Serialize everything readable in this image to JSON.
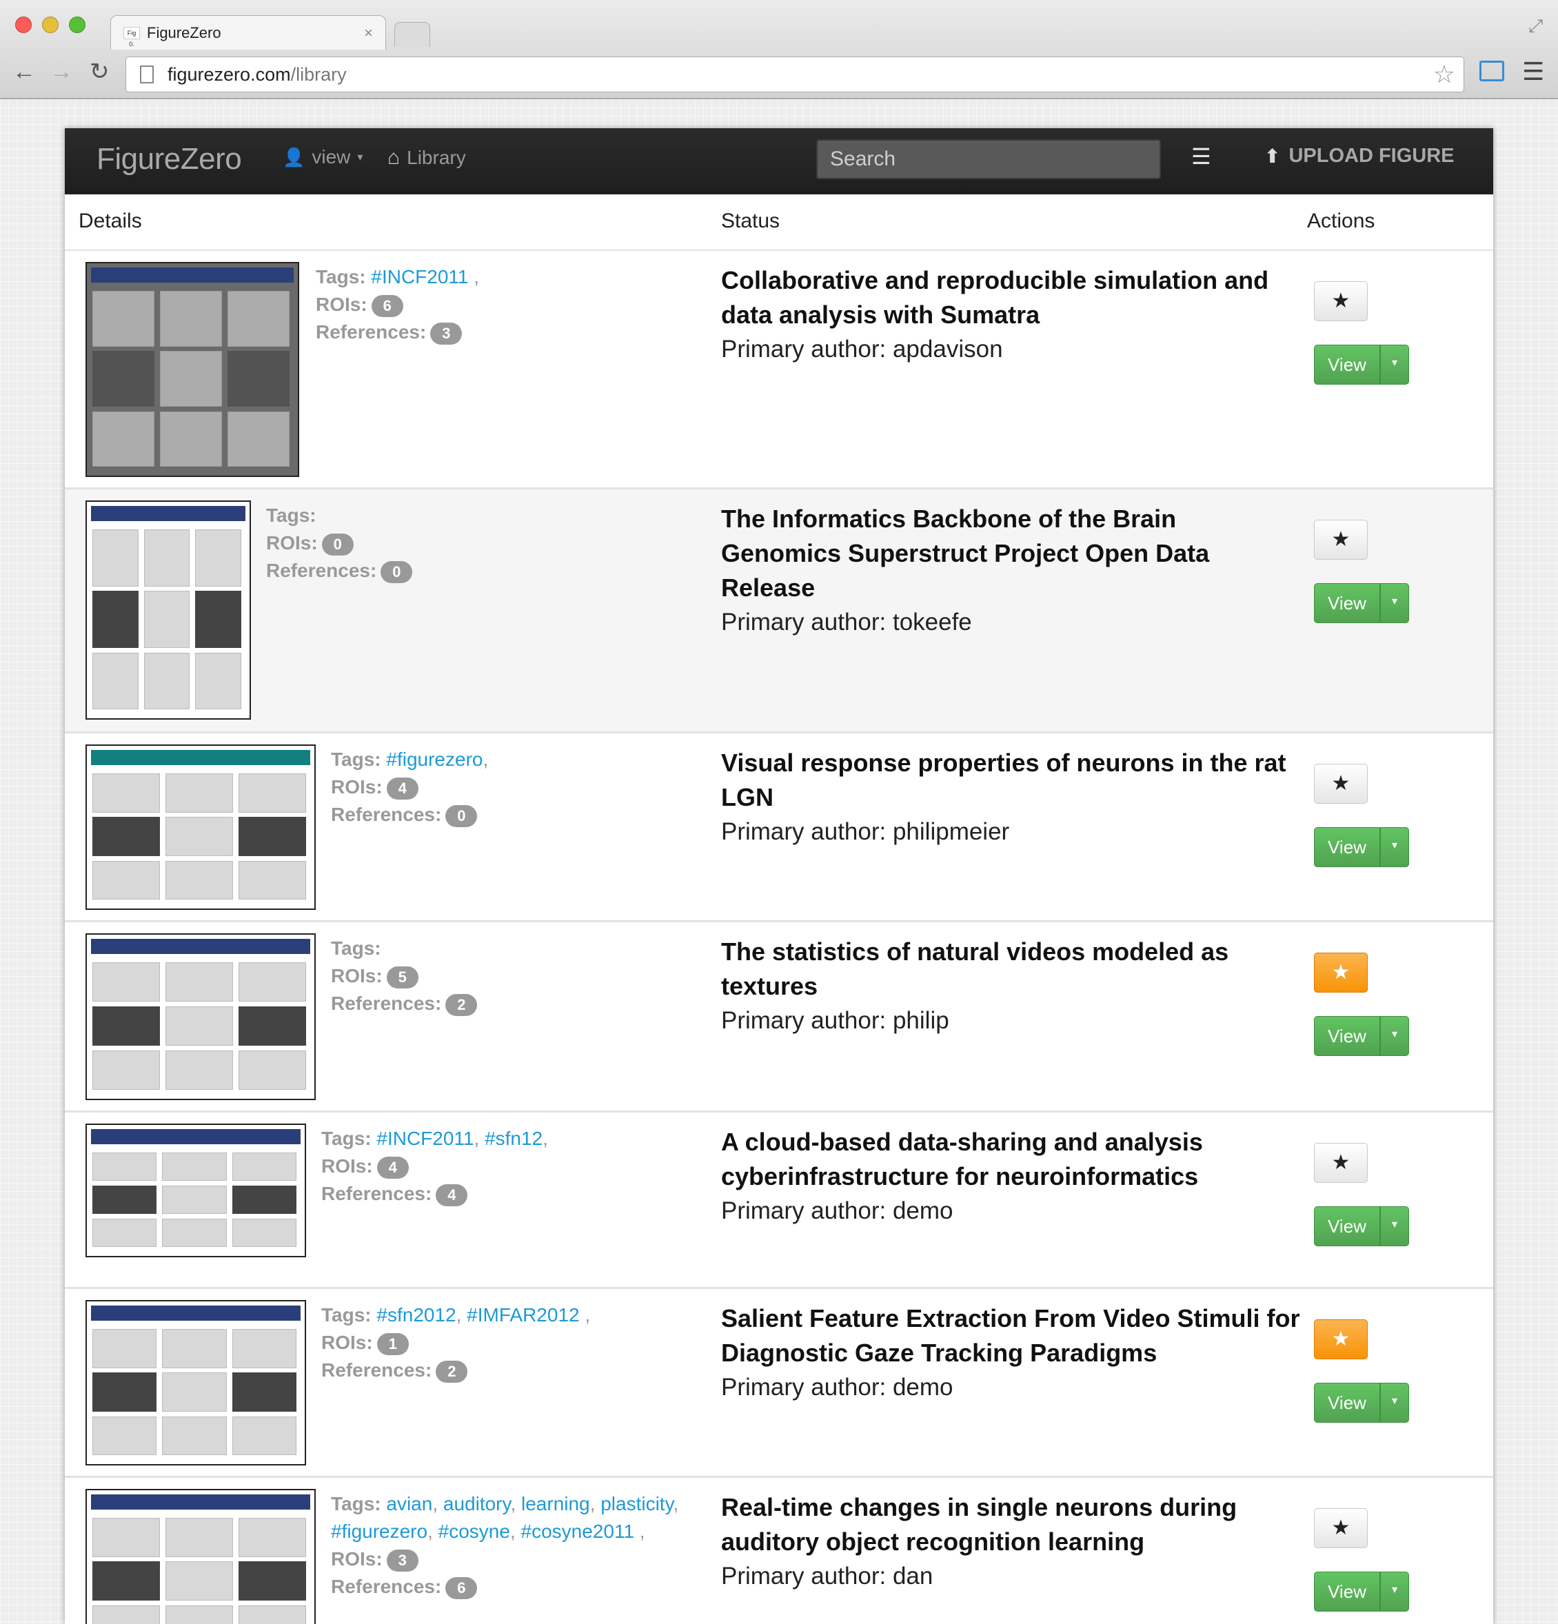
{
  "browser": {
    "tab_title": "FigureZero",
    "tab_favicon": "Fig 0.",
    "tab_close": "×",
    "url_host": "figurezero.com",
    "url_path": "/library",
    "back": "←",
    "forward": "→",
    "reload": "↻",
    "bookmark": "☆",
    "menu": "☰",
    "resize": "⤢"
  },
  "navbar": {
    "brand": "FigureZero",
    "user_icon": "👤",
    "user_label": "view",
    "caret": "▾",
    "home_icon": "⌂",
    "library_label": "Library",
    "search_placeholder": "Search",
    "list_icon": "☰",
    "upload_icon": "⬆",
    "upload_label": "UPLOAD FIGURE"
  },
  "table": {
    "headers": {
      "details": "Details",
      "status": "Status",
      "actions": "Actions"
    },
    "labels": {
      "tags": "Tags:",
      "rois": "ROIs:",
      "references": "References:"
    },
    "star_glyph": "★",
    "view_label": "View",
    "caret": "▾",
    "rows": [
      {
        "tags": [
          "#INCF2011"
        ],
        "tags_suffix": " ,",
        "rois": "6",
        "references": "3",
        "title": "Collaborative and reproducible simulation and data analysis with Sumatra",
        "author": "Primary author: apdavison",
        "starred": false
      },
      {
        "tags": [],
        "tags_suffix": "",
        "rois": "0",
        "references": "0",
        "title": "The Informatics Backbone of the Brain Genomics Superstruct Project Open Data Release",
        "author": "Primary author: tokeefe",
        "starred": false
      },
      {
        "tags": [
          "#figurezero"
        ],
        "tags_suffix": ",",
        "rois": "4",
        "references": "0",
        "title": "Visual response properties of neurons in the rat LGN",
        "author": "Primary author: philipmeier",
        "starred": false
      },
      {
        "tags": [],
        "tags_suffix": "",
        "rois": "5",
        "references": "2",
        "title": "The statistics of natural videos modeled as textures",
        "author": "Primary author: philip",
        "starred": true
      },
      {
        "tags": [
          "#INCF2011",
          "#sfn12"
        ],
        "tags_suffix": ",",
        "rois": "4",
        "references": "4",
        "title": "A cloud-based data-sharing and analysis cyberinfrastructure for neuroinformatics",
        "author": "Primary author: demo",
        "starred": false
      },
      {
        "tags": [
          "#sfn2012",
          "#IMFAR2012"
        ],
        "tags_suffix": " ,",
        "rois": "1",
        "references": "2",
        "title": "Salient Feature Extraction From Video Stimuli for Diagnostic Gaze Tracking Paradigms",
        "author": "Primary author: demo",
        "starred": true
      },
      {
        "tags": [
          "avian",
          "auditory",
          "learning",
          "plasticity",
          "#figurezero",
          "#cosyne",
          "#cosyne2011"
        ],
        "tags_suffix": " ,",
        "rois": "3",
        "references": "6",
        "title": "Real-time changes in single neurons during auditory object recognition learning",
        "author": "Primary author: dan",
        "starred": false
      }
    ]
  },
  "colors": {
    "link": "#1c9ad6",
    "badge": "#999999",
    "view_green": "#5bb75b",
    "star_orange": "#f89406",
    "navbar": "#222222"
  }
}
